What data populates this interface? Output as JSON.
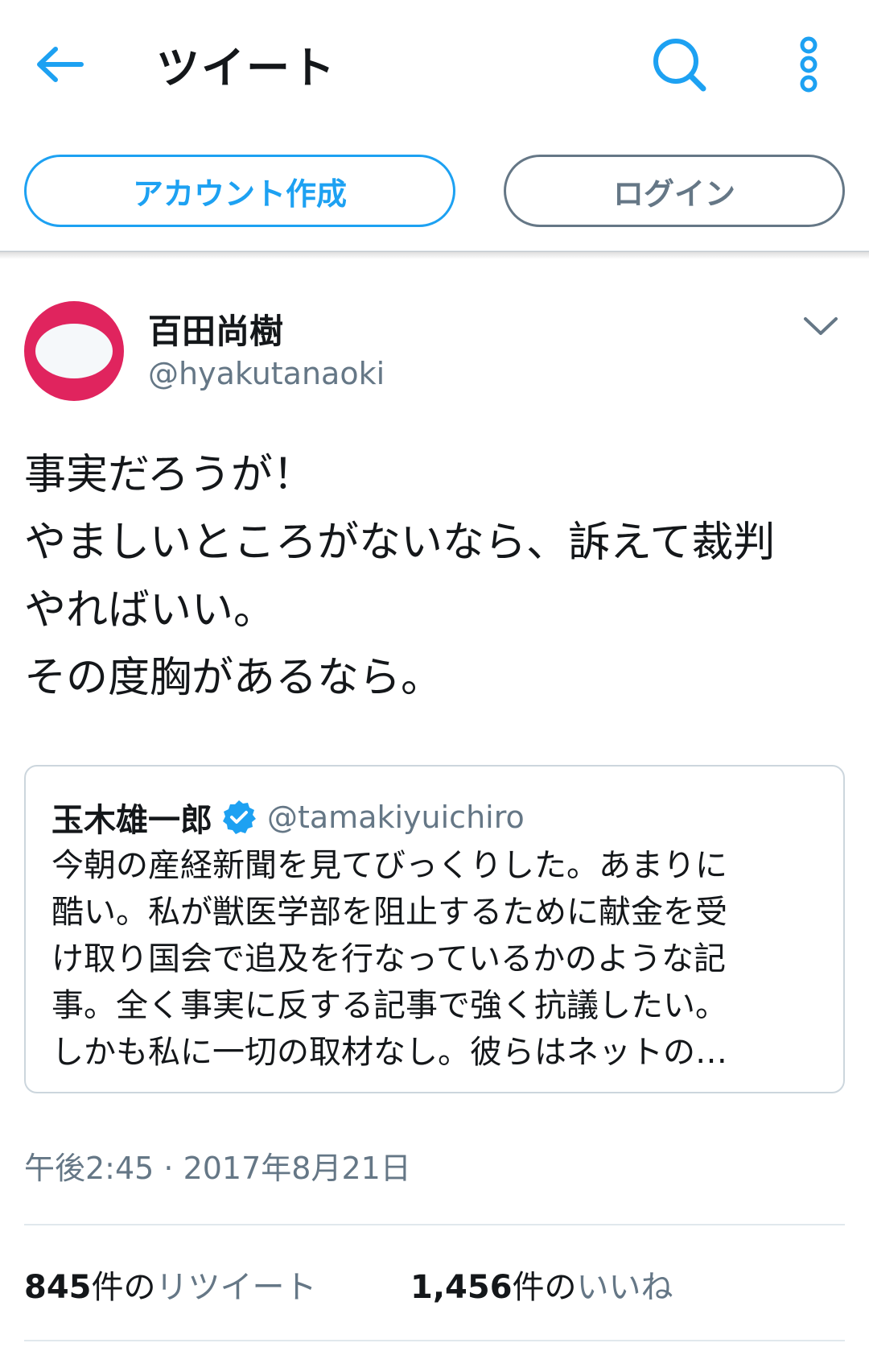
{
  "header": {
    "title": "ツイート",
    "back_icon": "arrow-left-icon",
    "search_icon": "search-icon",
    "more_icon": "vertical-ellipsis-icon"
  },
  "auth": {
    "create_account_label": "アカウント作成",
    "login_label": "ログイン"
  },
  "tweet": {
    "author_name": "百田尚樹",
    "author_handle": "@hyakutanaoki",
    "avatar_icon": "avatar-icon",
    "caret_icon": "chevron-down-icon",
    "text_lines": [
      "事実だろうが！",
      "やましいところがないなら、訴えて裁判",
      "やればいい。",
      "その度胸があるなら。"
    ],
    "quote": {
      "author_name": "玉木雄一郎",
      "verified_icon": "verified-badge-icon",
      "author_handle": "@tamakiyuichiro",
      "text_lines": [
        "今朝の産経新聞を見てびっくりした。あまりに",
        "酷い。私が獣医学部を阻止するために献金を受",
        "け取り国会で追及を行なっているかのような記",
        "事。全く事実に反する記事で強く抗議したい。",
        "しかも私に一切の取材なし。彼らはネットの…"
      ]
    },
    "timestamp": "午後2:45 · 2017年8月21日",
    "stats": {
      "retweet_count": "845",
      "retweet_unit": "件の",
      "retweet_label": "リツイート",
      "like_count": "1,456",
      "like_unit": "件の",
      "like_label": "いいね"
    }
  },
  "colors": {
    "accent": "#1da1f2",
    "secondary_text": "#657786",
    "primary_text": "#14171a",
    "avatar_bg": "#e0245e",
    "border": "#e1e8ed"
  }
}
